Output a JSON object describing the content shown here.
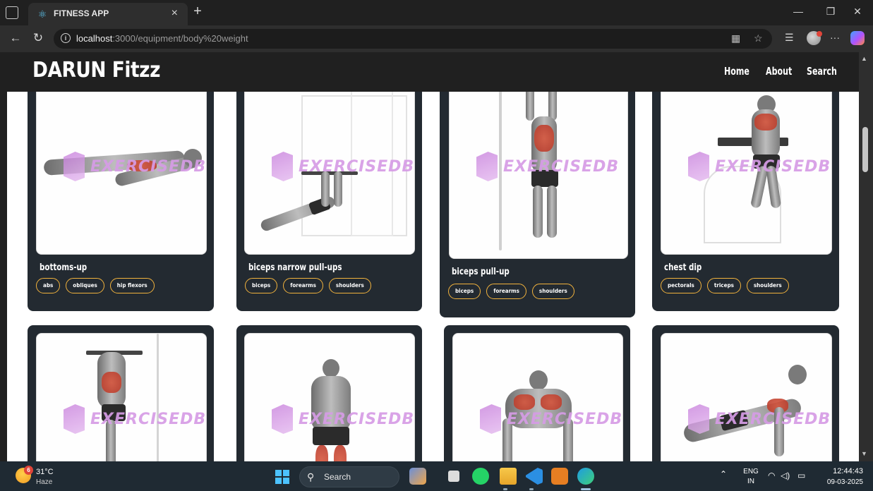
{
  "browser": {
    "tab_title": "FITNESS APP",
    "tab_close": "×",
    "new_tab": "+",
    "url_host": "localhost",
    "url_rest": ":3000/equipment/body%20weight",
    "window_minimize": "—",
    "window_restore": "❐",
    "window_close": "✕"
  },
  "site": {
    "brand": "DARUN Fitzz",
    "nav": [
      "Home",
      "About",
      "Search"
    ]
  },
  "watermark": "EXERCISEDB",
  "cards": [
    {
      "title": "bottoms-up",
      "tags": [
        "abs",
        "obliques",
        "hip flexors"
      ]
    },
    {
      "title": "biceps narrow pull-ups",
      "tags": [
        "biceps",
        "forearms",
        "shoulders"
      ]
    },
    {
      "title": "biceps pull-up",
      "tags": [
        "biceps",
        "forearms",
        "shoulders"
      ]
    },
    {
      "title": "chest dip",
      "tags": [
        "pectorals",
        "triceps",
        "shoulders"
      ]
    }
  ],
  "taskbar": {
    "weather_badge": "6",
    "temperature": "31°C",
    "condition": "Haze",
    "search_placeholder": "Search",
    "lang_top": "ENG",
    "lang_bottom": "IN",
    "time": "12:44:43",
    "date": "09-03-2025"
  },
  "icons": {
    "favicon": "react-icon",
    "back": "arrow-left-icon",
    "refresh": "refresh-icon",
    "info": "info-icon",
    "reader": "reader-mode-icon",
    "favorite": "star-icon",
    "favorites_bar": "favorites-icon",
    "more": "ellipsis-icon",
    "copilot": "copilot-icon"
  }
}
